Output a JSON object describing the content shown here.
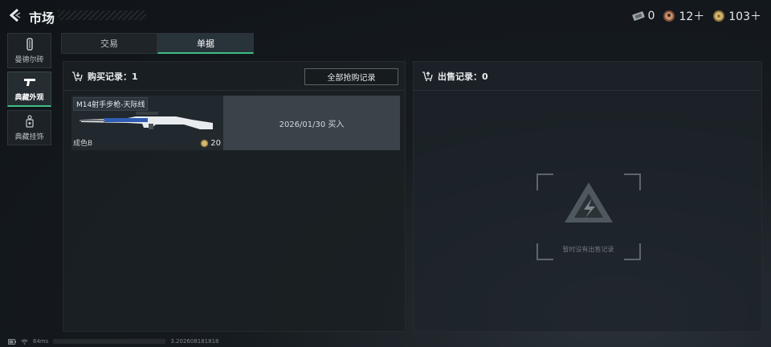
{
  "header": {
    "title": "市场",
    "currencies": [
      {
        "icon": "ticket-icon",
        "value": "0"
      },
      {
        "icon": "medal-coin-icon",
        "value": "12＋"
      },
      {
        "icon": "gold-coin-icon",
        "value": "103＋"
      }
    ]
  },
  "sidebar": {
    "items": [
      {
        "label": "曼德尔砖",
        "icon": "mandel-brick-icon"
      },
      {
        "label": "典藏外观",
        "icon": "pistol-icon"
      },
      {
        "label": "典藏挂饰",
        "icon": "charm-icon"
      }
    ]
  },
  "tabs": [
    {
      "label": "交易"
    },
    {
      "label": "单据"
    }
  ],
  "purchase": {
    "title": "购买记录：1",
    "all_button": "全部抢购记录",
    "records": [
      {
        "item_name": "M14射手步枪-天际线",
        "grade": "成色B",
        "price": "20",
        "date": "2026/01/30 买入"
      }
    ]
  },
  "sale": {
    "title": "出售记录：0",
    "empty_text": "暂时没有出售记录"
  },
  "status": {
    "ping": "64ms",
    "build": "3.202608181818"
  },
  "colors": {
    "accent": "#3dbd86",
    "panel": "#1a1f23",
    "record_date_bg": "#3a4349"
  }
}
